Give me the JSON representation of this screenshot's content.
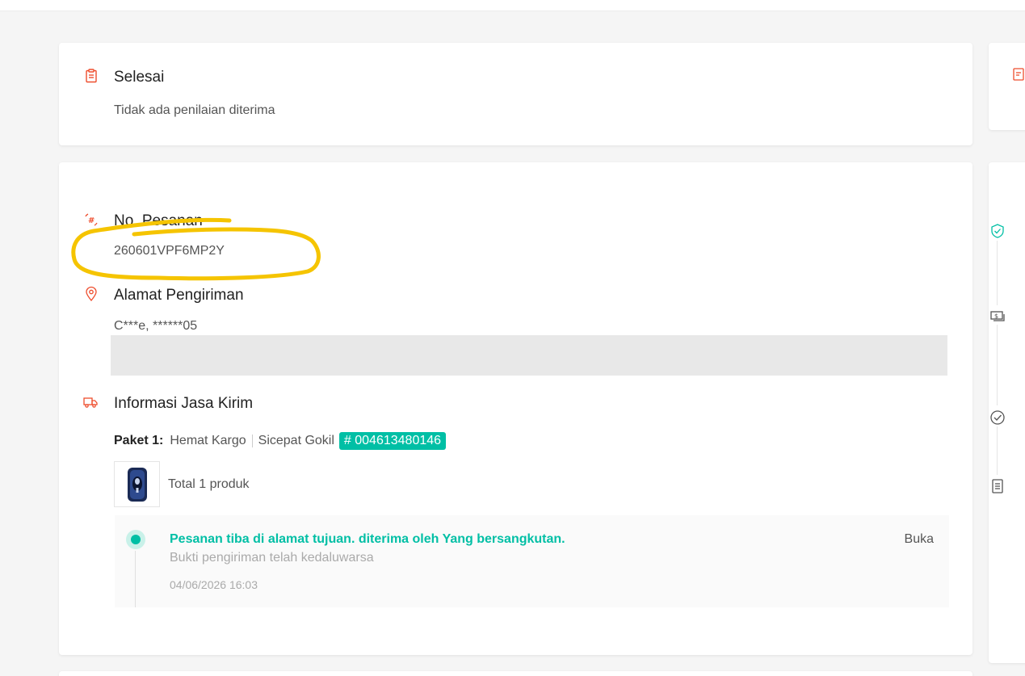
{
  "status": {
    "title": "Selesai",
    "subtitle": "Tidak ada penilaian diterima"
  },
  "order": {
    "title": "No. Pesanan",
    "number": "260601VPF6MP2Y"
  },
  "address": {
    "title": "Alamat Pengiriman",
    "recipient": "C***e, ******05"
  },
  "shipping": {
    "title": "Informasi Jasa Kirim",
    "package_label": "Paket 1:",
    "service": "Hemat Kargo",
    "courier": "Sicepat Gokil",
    "tracking_number": "# 004613480146",
    "total_products": "Total 1 produk"
  },
  "tracking": {
    "event": "Pesanan tiba di alamat tujuan. diterima oleh Yang bersangkutan.",
    "note": "Bukti pengiriman telah kedaluwarsa",
    "timestamp": "04/06/2026 16:03",
    "open_label": "Buka"
  },
  "colors": {
    "accent": "#ee4d2d",
    "teal": "#00bfa5",
    "highlight": "#f5c400"
  },
  "icons": {
    "status": "clipboard-icon",
    "order": "hash-icon",
    "address": "location-pin-icon",
    "shipping": "truck-icon",
    "side": [
      "shield-check-icon",
      "money-icon",
      "check-circle-icon",
      "document-icon"
    ]
  }
}
